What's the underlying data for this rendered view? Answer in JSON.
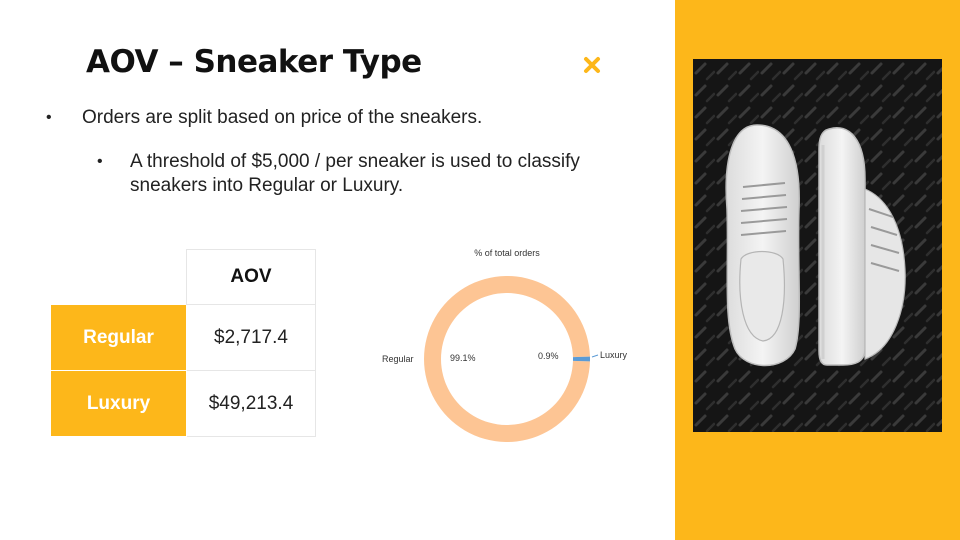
{
  "slide": {
    "title": "AOV – Sneaker Type",
    "bullets": {
      "level1": "Orders are split based on price of the sneakers.",
      "level2": "A threshold of $5,000 / per sneaker is used to classify sneakers into Regular or Luxury."
    },
    "bullet_glyph": "•",
    "accent_color": "#FDB71A"
  },
  "table": {
    "header": "AOV",
    "rows": [
      {
        "label": "Regular",
        "value": "$2,717.4"
      },
      {
        "label": "Luxury",
        "value": "$49,213.4"
      }
    ]
  },
  "chart_data": {
    "type": "pie",
    "title": "% of total orders",
    "categories": [
      "Regular",
      "Luxury"
    ],
    "values": [
      99.1,
      0.9
    ],
    "data_labels": [
      "99.1%",
      "0.9%"
    ],
    "colors": [
      "#FDC594",
      "#5B9BD5"
    ],
    "style": "donut"
  },
  "image": {
    "subject": "white sneakers on black textured metal floor"
  }
}
